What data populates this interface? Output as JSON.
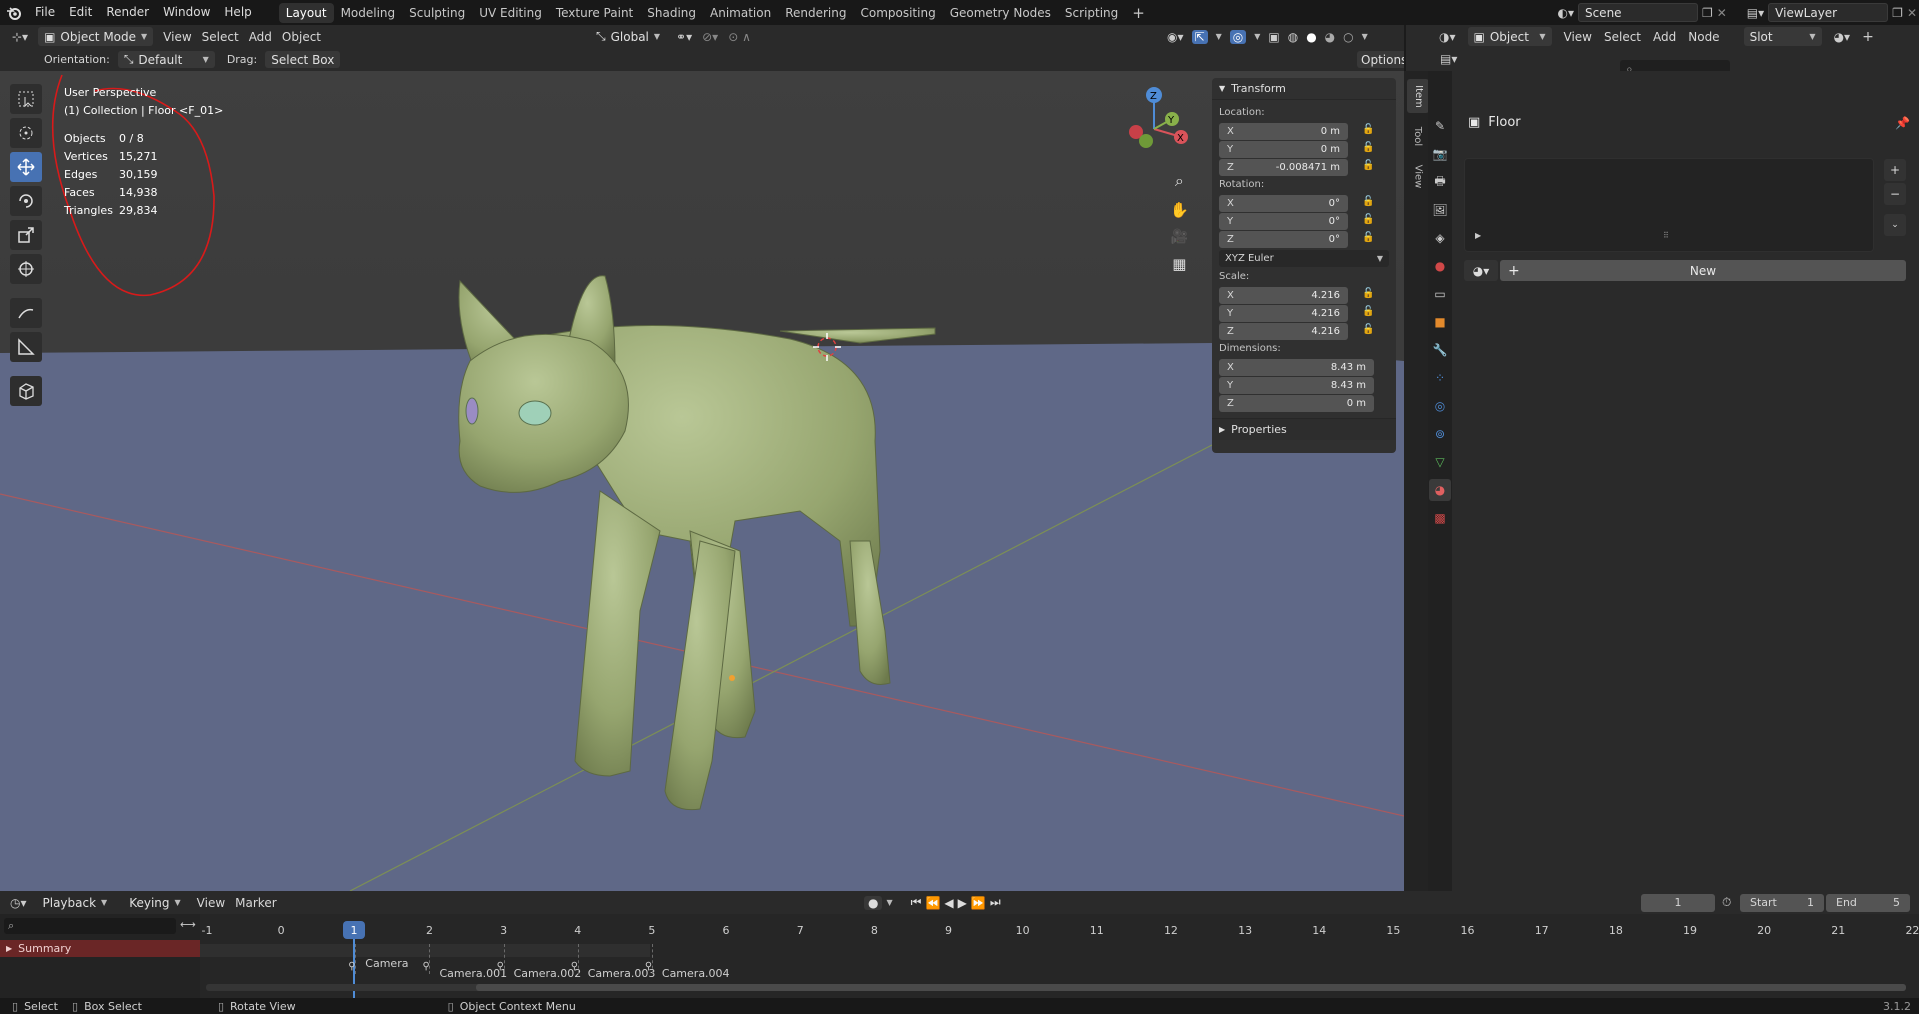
{
  "topbar": {
    "menus": [
      "File",
      "Edit",
      "Render",
      "Window",
      "Help"
    ],
    "workspaces": [
      "Layout",
      "Modeling",
      "Sculpting",
      "UV Editing",
      "Texture Paint",
      "Shading",
      "Animation",
      "Rendering",
      "Compositing",
      "Geometry Nodes",
      "Scripting"
    ],
    "active_workspace": "Layout",
    "scene": "Scene",
    "view_layer": "ViewLayer"
  },
  "viewport_header": {
    "mode": "Object Mode",
    "menus": [
      "View",
      "Select",
      "Add",
      "Object"
    ],
    "transform_orientation": "Global"
  },
  "tool_settings": {
    "orientation_label": "Orientation:",
    "orientation_value": "Default",
    "drag_label": "Drag:",
    "drag_value": "Select Box",
    "options_label": "Options"
  },
  "overlay": {
    "view_name": "User Perspective",
    "collection_info": "(1) Collection | Floor <F_01>",
    "stats": [
      {
        "label": "Objects",
        "value": "0 / 8"
      },
      {
        "label": "Vertices",
        "value": "15,271"
      },
      {
        "label": "Edges",
        "value": "30,159"
      },
      {
        "label": "Faces",
        "value": "14,938"
      },
      {
        "label": "Triangles",
        "value": "29,834"
      }
    ]
  },
  "gizmo": {
    "axes": [
      "X",
      "Y",
      "Z"
    ]
  },
  "npanel": {
    "tabs": [
      "Item",
      "Tool",
      "View"
    ],
    "transform_title": "Transform",
    "location_label": "Location:",
    "location": [
      {
        "axis": "X",
        "value": "0 m"
      },
      {
        "axis": "Y",
        "value": "0 m"
      },
      {
        "axis": "Z",
        "value": "-0.008471 m"
      }
    ],
    "rotation_label": "Rotation:",
    "rotation": [
      {
        "axis": "X",
        "value": "0°"
      },
      {
        "axis": "Y",
        "value": "0°"
      },
      {
        "axis": "Z",
        "value": "0°"
      }
    ],
    "rotation_mode": "XYZ Euler",
    "scale_label": "Scale:",
    "scale": [
      {
        "axis": "X",
        "value": "4.216"
      },
      {
        "axis": "Y",
        "value": "4.216"
      },
      {
        "axis": "Z",
        "value": "4.216"
      }
    ],
    "dimensions_label": "Dimensions:",
    "dimensions": [
      {
        "axis": "X",
        "value": "8.43 m"
      },
      {
        "axis": "Y",
        "value": "8.43 m"
      },
      {
        "axis": "Z",
        "value": "0 m"
      }
    ],
    "properties_title": "Properties"
  },
  "right_editor": {
    "header_object": "Object",
    "menus": [
      "View",
      "Select",
      "Add",
      "Node"
    ],
    "slot": "Slot",
    "object_name": "Floor",
    "new_button": "New"
  },
  "timeline": {
    "menus": [
      "Playback",
      "Keying",
      "View",
      "Marker"
    ],
    "current_frame": "1",
    "start_label": "Start",
    "start_value": "1",
    "end_label": "End",
    "end_value": "5",
    "ruler": [
      "-1",
      "0",
      "1",
      "2",
      "3",
      "4",
      "5",
      "6",
      "7",
      "8",
      "9",
      "10",
      "11",
      "12",
      "13",
      "14",
      "15",
      "16",
      "17",
      "18",
      "19",
      "20",
      "21",
      "22"
    ],
    "summary_label": "Summary",
    "markers": [
      "Camera",
      "Camera.001",
      "Camera.002",
      "Camera.003",
      "Camera.004"
    ]
  },
  "statusbar": {
    "items": [
      "Select",
      "Box Select",
      "Rotate View",
      "Object Context Menu"
    ],
    "version": "3.1.2"
  }
}
